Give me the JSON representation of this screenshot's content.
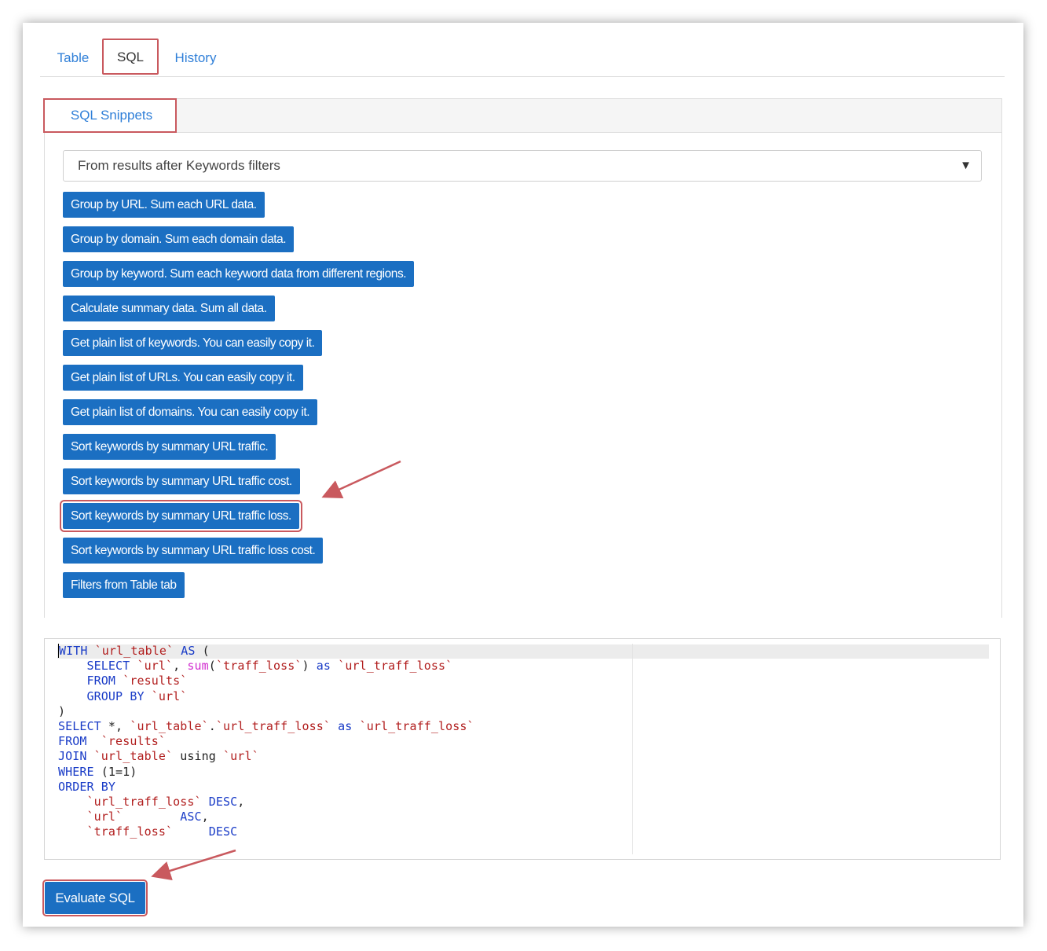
{
  "tabs": [
    {
      "label": "Table"
    },
    {
      "label": "SQL"
    },
    {
      "label": "History"
    }
  ],
  "panel": {
    "title": "SQL Snippets",
    "source_select": {
      "value": "From results after Keywords filters"
    }
  },
  "snippets": [
    {
      "label": "Group by URL. Sum each URL data."
    },
    {
      "label": "Group by domain. Sum each domain data."
    },
    {
      "label": "Group by keyword. Sum each keyword data from different regions."
    },
    {
      "label": "Calculate summary data. Sum all data."
    },
    {
      "label": "Get plain list of keywords. You can easily copy it."
    },
    {
      "label": "Get plain list of URLs. You can easily copy it."
    },
    {
      "label": "Get plain list of domains. You can easily copy it."
    },
    {
      "label": "Sort keywords by summary URL traffic."
    },
    {
      "label": "Sort keywords by summary URL traffic cost."
    },
    {
      "label": "Sort keywords by summary URL traffic loss."
    },
    {
      "label": "Sort keywords by summary URL traffic loss cost."
    },
    {
      "label": "Filters from Table tab"
    }
  ],
  "sql_code": [
    "WITH `url_table` AS (",
    "    SELECT `url`, sum(`traff_loss`) as `url_traff_loss`",
    "    FROM `results`",
    "    GROUP BY `url`",
    ")",
    "SELECT *, `url_table`.`url_traff_loss` as `url_traff_loss`",
    "FROM  `results`",
    "JOIN `url_table` using `url`",
    "WHERE (1=1)",
    "ORDER BY",
    "    `url_traff_loss` DESC,",
    "    `url`        ASC,",
    "    `traff_loss`     DESC"
  ],
  "actions": {
    "evaluate_label": "Evaluate SQL"
  },
  "colors": {
    "accent_blue": "#1b6fc2",
    "link_blue": "#2f7fd8",
    "highlight_red": "#c9595e"
  }
}
